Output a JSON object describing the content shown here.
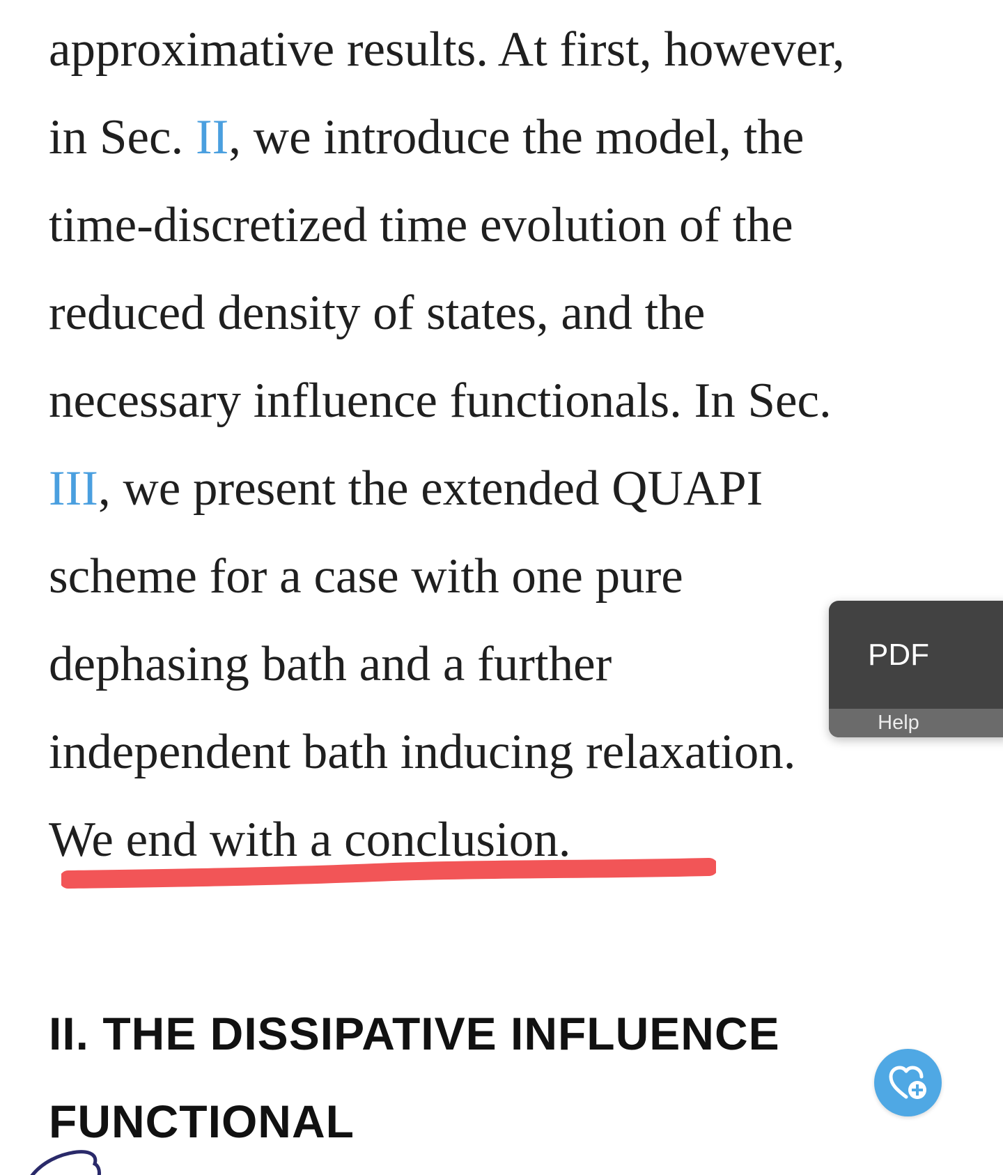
{
  "article": {
    "paragraph_lines": [
      [
        "approximative results. At first, however,"
      ],
      [
        "in Sec. ",
        {
          "link": "II"
        },
        ", we introduce the model, the"
      ],
      [
        "time-discretized time evolution of the"
      ],
      [
        "reduced density of states, and the"
      ],
      [
        "necessary influence functionals. In Sec."
      ],
      [
        {
          "link": "III"
        },
        ", we present the extended QUAPI"
      ],
      [
        "scheme for a case with one pure"
      ],
      [
        "dephasing bath and a further"
      ],
      [
        "independent bath inducing relaxation."
      ],
      [
        "We end with a conclusion."
      ]
    ],
    "section_heading_lines": [
      "II. THE DISSIPATIVE INFLUENCE",
      "FUNCTIONAL"
    ]
  },
  "pdf_widget": {
    "pdf_label": "PDF",
    "help_label": "Help"
  },
  "colors": {
    "link": "#4a9fdf",
    "underline_mark": "#f25557",
    "pdf_widget_bg": "#424242",
    "help_bg": "#6b6b6b",
    "fav_button": "#4fa8e4",
    "corner_mark": "#2a2a6a"
  },
  "icons": {
    "fav_button": "heart-plus-icon",
    "corner": "pen-stroke-mark"
  }
}
